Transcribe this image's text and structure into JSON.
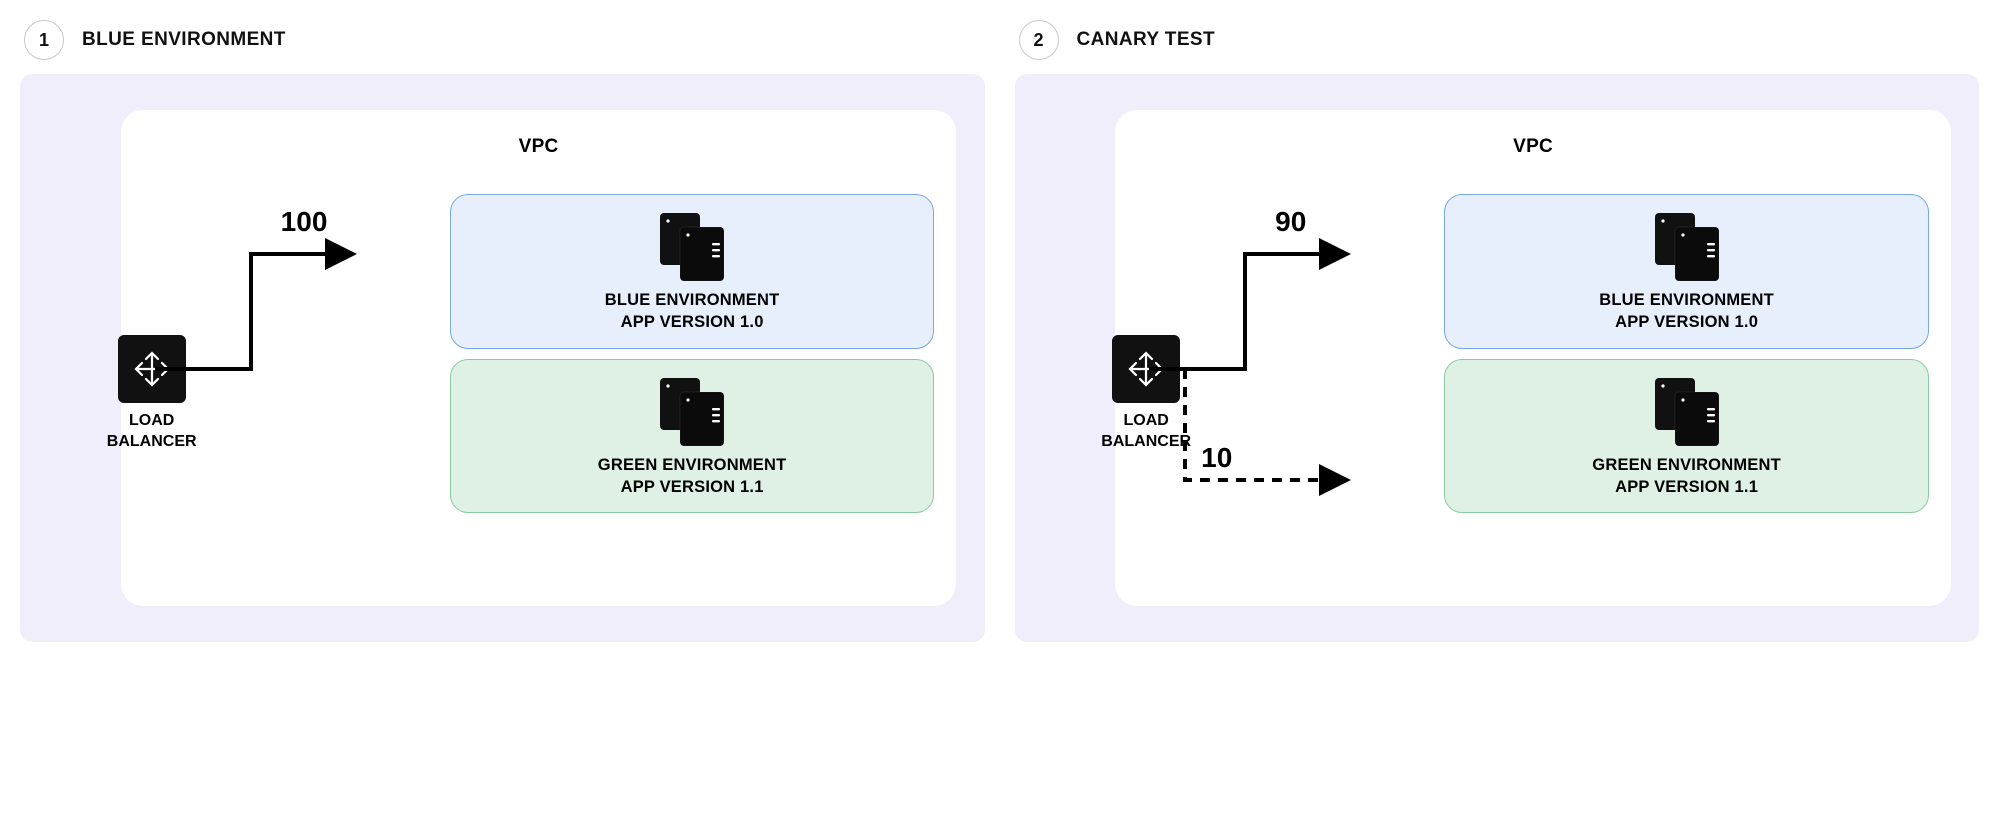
{
  "panels": [
    {
      "step": "1",
      "title": "BLUE ENVIRONMENT",
      "vpc_label": "VPC",
      "load_balancer_label_l1": "LOAD",
      "load_balancer_label_l2": "BALANCER",
      "weight_blue": "100",
      "weight_green": "",
      "arrow_green_visible": false,
      "blue_env_l1": "BLUE ENVIRONMENT",
      "blue_env_l2": "APP VERSION 1.0",
      "green_env_l1": "GREEN ENVIRONMENT",
      "green_env_l2": "APP VERSION 1.1"
    },
    {
      "step": "2",
      "title": "CANARY TEST",
      "vpc_label": "VPC",
      "load_balancer_label_l1": "LOAD",
      "load_balancer_label_l2": "BALANCER",
      "weight_blue": "90",
      "weight_green": "10",
      "arrow_green_visible": true,
      "blue_env_l1": "BLUE ENVIRONMENT",
      "blue_env_l2": "APP VERSION 1.0",
      "green_env_l1": "GREEN ENVIRONMENT",
      "green_env_l2": "APP VERSION 1.1"
    }
  ]
}
